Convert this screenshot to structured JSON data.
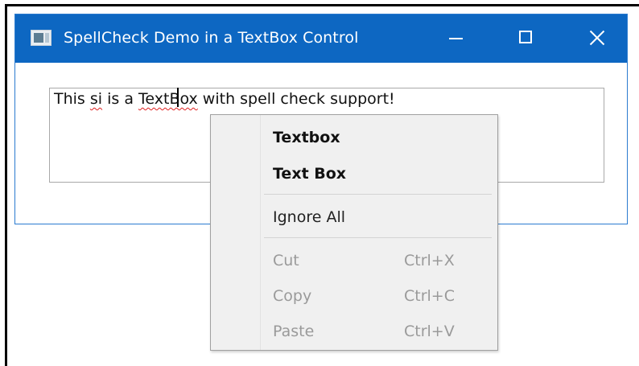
{
  "window": {
    "title": "SpellCheck Demo in a TextBox Control",
    "app_icon": "window-app-icon",
    "controls": {
      "minimize_icon": "minimize-icon",
      "maximize_icon": "maximize-icon",
      "close_icon": "close-icon"
    },
    "titlebar_color": "#0d67c2"
  },
  "textbox": {
    "segments": [
      {
        "text": "This ",
        "misspelled": false
      },
      {
        "text": "si",
        "misspelled": true
      },
      {
        "text": " is a ",
        "misspelled": false
      },
      {
        "text": "TextBox",
        "misspelled": true
      },
      {
        "text": " with spell check support!",
        "misspelled": false
      }
    ],
    "underline_color": "#e02020"
  },
  "context_menu": {
    "suggestions": [
      "Textbox",
      "Text Box"
    ],
    "ignore_all": "Ignore All",
    "edit_items": [
      {
        "label": "Cut",
        "shortcut": "Ctrl+X",
        "enabled": false
      },
      {
        "label": "Copy",
        "shortcut": "Ctrl+C",
        "enabled": false
      },
      {
        "label": "Paste",
        "shortcut": "Ctrl+V",
        "enabled": false
      }
    ]
  }
}
